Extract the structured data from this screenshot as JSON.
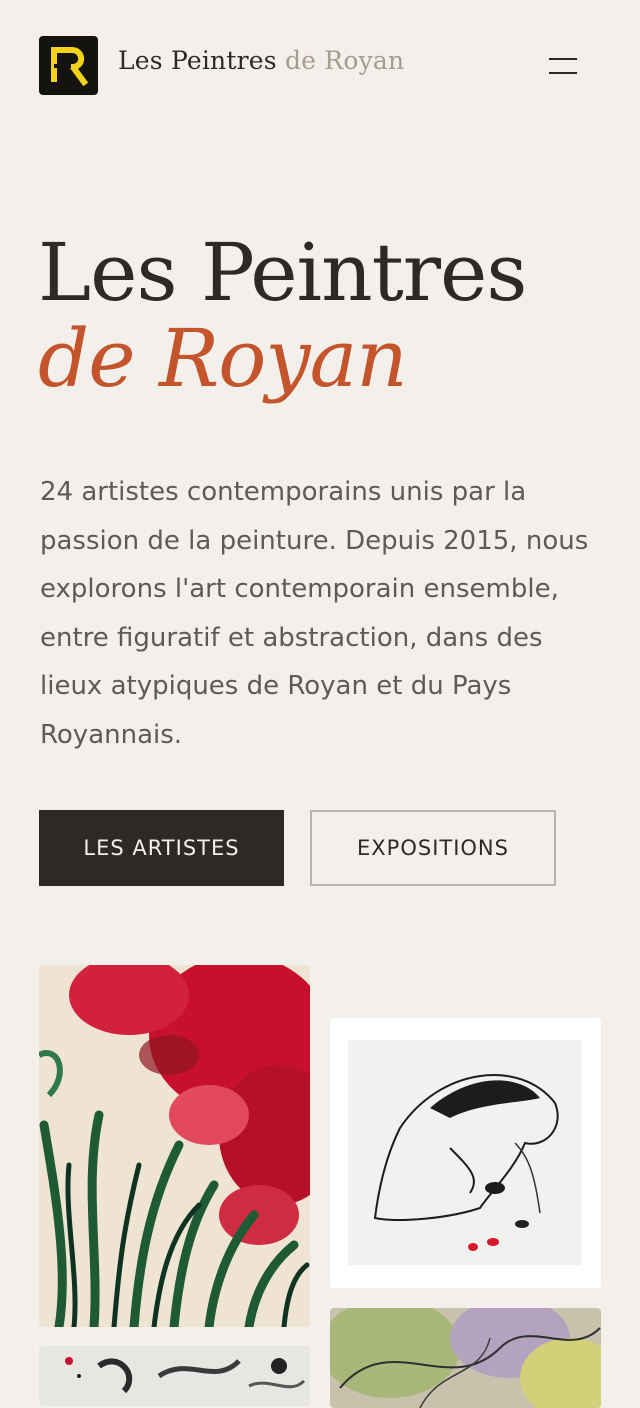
{
  "header": {
    "logo_icon": "logo-r-mark",
    "brand": {
      "part1": "Les Peintres",
      "part2": "de Royan"
    },
    "menu_icon": "hamburger-menu-icon"
  },
  "hero": {
    "title_line1": "Les Peintres",
    "title_line2": "de Royan",
    "intro": "24 artistes contemporains unis par la passion de la peinture. Depuis 2015, nous explorons l'art contemporain ensemble, entre figuratif et abstraction, dans des lieux atypiques de Royan et du Pays Royannais."
  },
  "actions": {
    "primary_label": "LES ARTISTES",
    "secondary_label": "EXPOSITIONS"
  },
  "gallery": {
    "items": [
      {
        "kind": "painting-red-flowers"
      },
      {
        "kind": "drawing-ink-figure"
      },
      {
        "kind": "painting-ink-splatter"
      },
      {
        "kind": "painting-green-abstract"
      }
    ]
  },
  "colors": {
    "background": "#f3f0ec",
    "text": "#2d2a26",
    "accent": "#c4542c",
    "brand_muted": "#a69c8d",
    "logo_yellow": "#f2d21a"
  }
}
